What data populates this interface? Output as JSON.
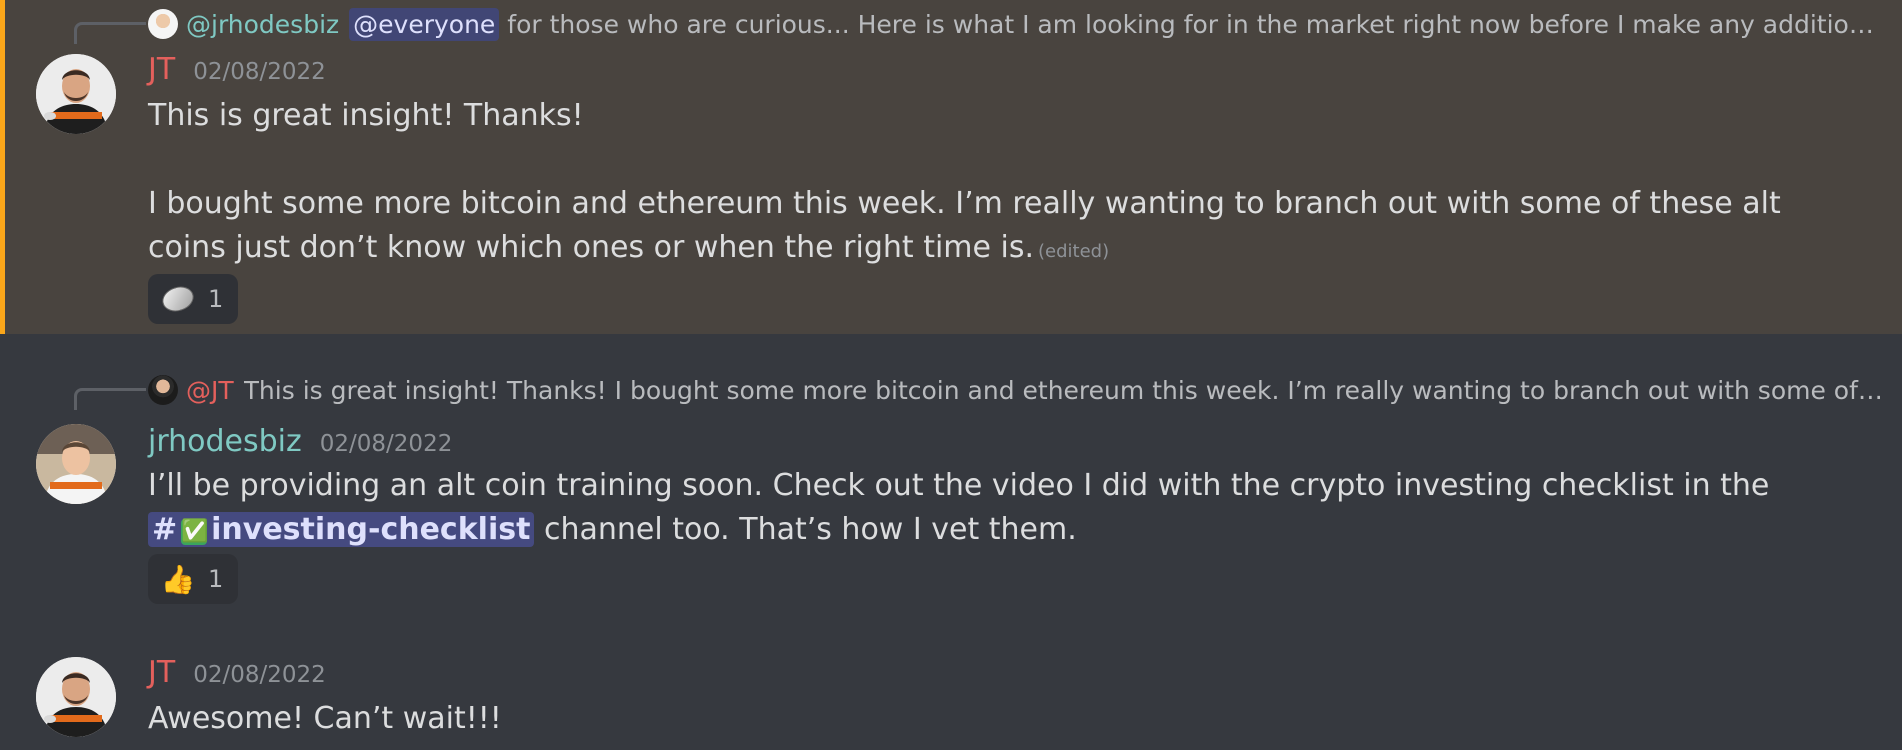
{
  "messages": [
    {
      "author": "JT",
      "timestamp": "02/08/2022",
      "reply": {
        "mention": "@jrhodesbiz",
        "everyone": "@everyone",
        "text": "for those who are curious... Here is what I am looking for in the market right now before I make any additional tra..."
      },
      "paragraphs": [
        "This is great insight! Thanks!",
        "I bought some more bitcoin and ethereum this week. I’m really wanting to branch out with some of these alt coins just don’t know which ones or when the right time is."
      ],
      "edited_label": "(edited)",
      "reaction": {
        "emoji": "coin-emoji",
        "count": "1"
      }
    },
    {
      "author": "jrhodesbiz",
      "timestamp": "02/08/2022",
      "reply": {
        "mention": "@JT",
        "text": "This is great insight! Thanks!  I bought some more bitcoin and ethereum this week. I’m really wanting to branch out with some of thes..."
      },
      "text_before": "I’ll be providing an alt coin training soon. Check out the video I did with the crypto investing checklist in the ",
      "channel_hash": "#",
      "channel_emoji": "✅",
      "channel_name": "investing-checklist",
      "text_after": " channel too. That’s how I vet them.",
      "reaction": {
        "emoji": "👍",
        "count": "1"
      }
    },
    {
      "author": "JT",
      "timestamp": "02/08/2022",
      "text": "Awesome! Can’t wait!!!"
    }
  ],
  "colors": {
    "highlight_bg": "#49443f",
    "highlight_bar": "#faa61a",
    "jt_name": "#e4605c",
    "jrhodesbiz_name": "#7fc9c3",
    "mention_pill": "#414675"
  }
}
